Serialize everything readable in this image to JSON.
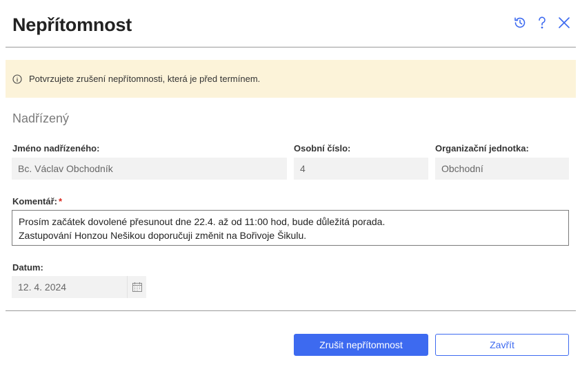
{
  "dialog": {
    "title": "Nepřítomnost",
    "header_icons": [
      "history-icon",
      "help-icon",
      "close-icon"
    ],
    "accent_color": "#3d6af0"
  },
  "banner": {
    "text": "Potvrzujete zrušení nepřítomnosti, která je před termínem.",
    "icon": "info-icon",
    "background": "#fcf3d9"
  },
  "supervisor": {
    "section_title": "Nadřízený",
    "name_label": "Jméno nadřízeného:",
    "name_value": "Bc. Václav Obchodník",
    "personal_number_label": "Osobní číslo:",
    "personal_number_value": "4",
    "org_unit_label": "Organizační jednotka:",
    "org_unit_value": "Obchodní"
  },
  "comment": {
    "label": "Komentář:",
    "required_mark": "*",
    "value": "Prosím začátek dovolené přesunout dne 22.4. až od 11:00 hod, bude důležitá porada.\nZastupování Honzou Nešikou doporučuji změnit na Bořivoje Šikulu."
  },
  "date": {
    "label": "Datum:",
    "value": "12. 4. 2024",
    "icon": "calendar-icon"
  },
  "footer": {
    "cancel_absence_label": "Zrušit nepřítomnost",
    "close_label": "Zavřít"
  }
}
